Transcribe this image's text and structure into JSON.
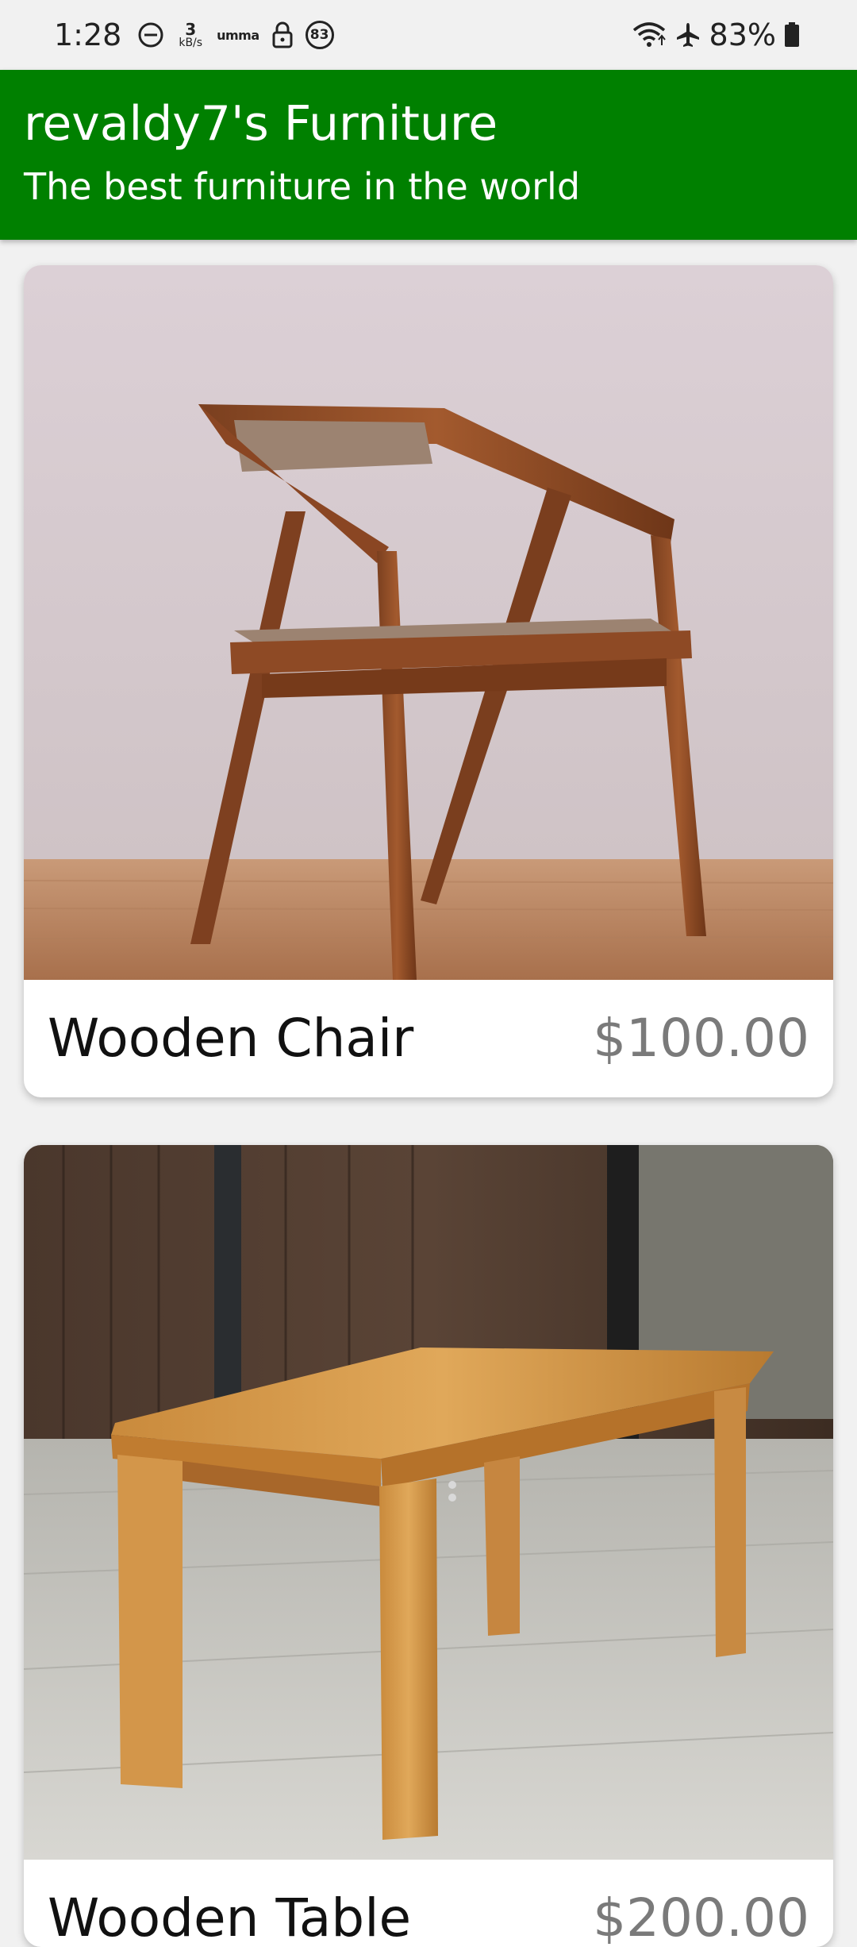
{
  "status_bar": {
    "time": "1:28",
    "net_speed_value": "3",
    "net_speed_unit": "kB/s",
    "carrier_label": "umma",
    "notification_count": "83",
    "battery_percent": "83%"
  },
  "app_bar": {
    "title": "revaldy7's Furniture",
    "subtitle": "The best furniture in the world"
  },
  "products": [
    {
      "name": "Wooden Chair",
      "price": "$100.00",
      "image": "wooden-chair-photo"
    },
    {
      "name": "Wooden Table",
      "price": "$200.00",
      "image": "wooden-table-photo"
    }
  ],
  "colors": {
    "app_bar": "#008000",
    "price_text": "#7a7a7a",
    "background": "#f1f1f1"
  }
}
